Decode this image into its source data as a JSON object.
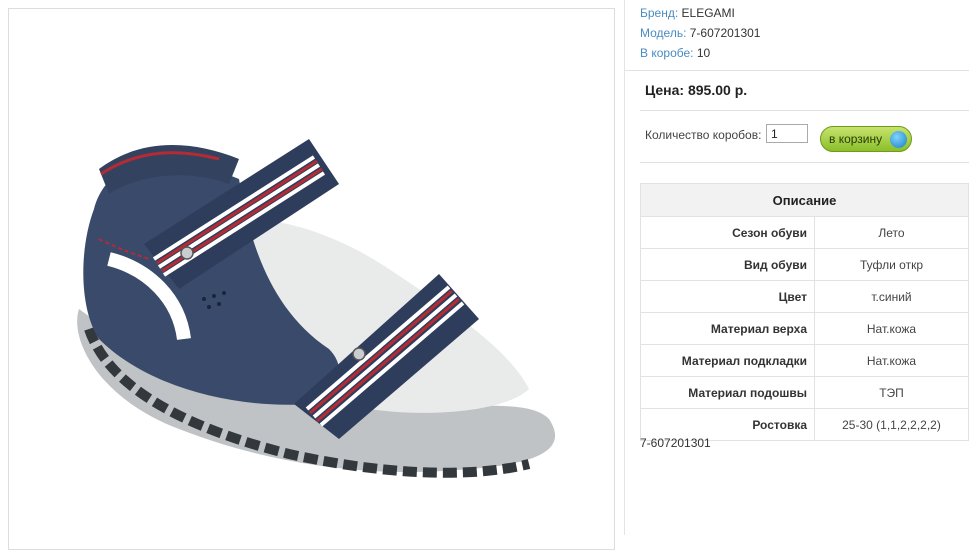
{
  "product": {
    "image_alt": "Сандалии ELEGAMI 7-607201301",
    "brand_label": "Бренд:",
    "brand_value": "ELEGAMI",
    "model_label": "Модель:",
    "model_value": "7-607201301",
    "box_label": "В коробе:",
    "box_value": "10"
  },
  "price": {
    "text": "Цена: 895.00 р."
  },
  "cart": {
    "qty_label": "Количество коробов:",
    "qty_value": "1",
    "button_label": "в корзину",
    "button_icon": "cart-add-icon"
  },
  "description": {
    "title": "Описание",
    "rows": [
      {
        "key": "Сезон обуви",
        "value": "Лето"
      },
      {
        "key": "Вид обуви",
        "value": "Туфли откр"
      },
      {
        "key": "Цвет",
        "value": "т.синий"
      },
      {
        "key": "Материал верха",
        "value": "Нат.кожа"
      },
      {
        "key": "Материал подкладки",
        "value": "Нат.кожа"
      },
      {
        "key": "Материал подошвы",
        "value": "ТЭП"
      },
      {
        "key": "Ростовка",
        "value": "25-30 (1,1,2,2,2,2)"
      }
    ]
  },
  "code": "7-607201301"
}
